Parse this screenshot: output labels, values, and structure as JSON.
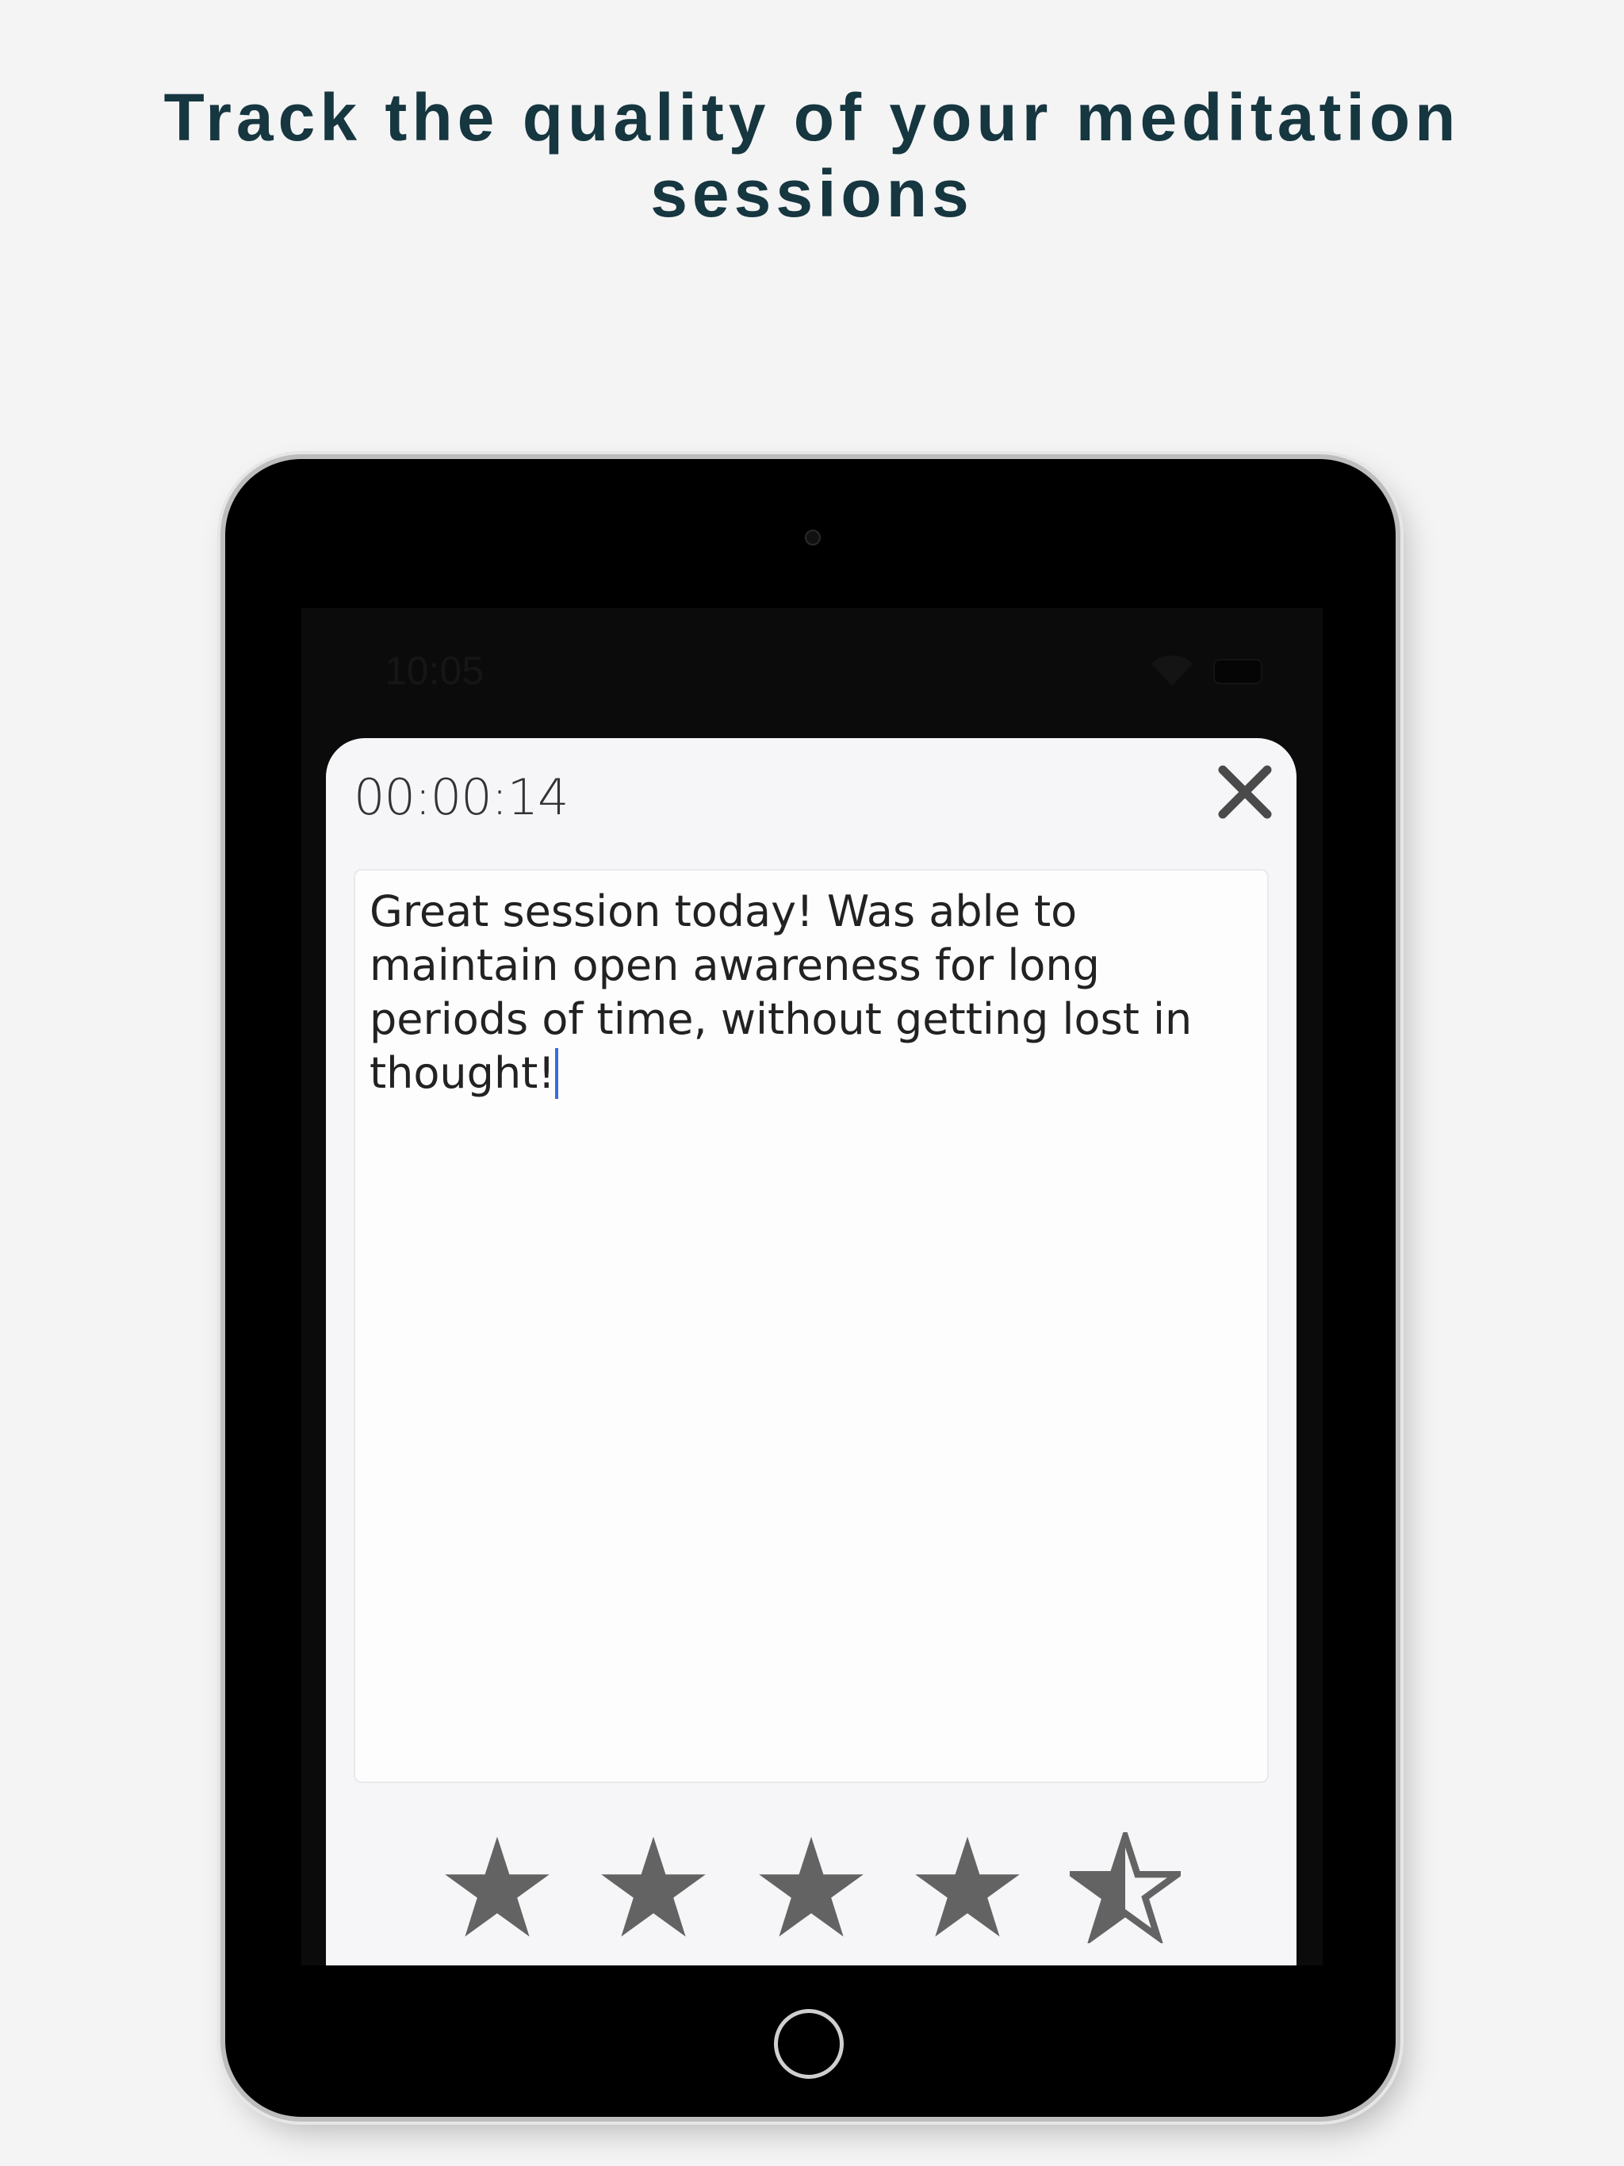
{
  "headline": "Track the quality of your meditation sessions",
  "status_bar": {
    "time": "10:05",
    "icons": [
      "signal-icon",
      "wifi-icon",
      "battery-icon"
    ]
  },
  "session": {
    "timer": "00:00:14",
    "close_icon": "close-icon",
    "notes_text": "Great session today!  Was able to maintain open awareness for long periods of time, without getting lost in thought!",
    "rating": 4.5,
    "rating_max": 5,
    "star_color": "#636363"
  },
  "colors": {
    "headline": "#163640",
    "background": "#f4f4f4",
    "sheet": "#f6f5f8",
    "caret": "#3a6be0"
  }
}
